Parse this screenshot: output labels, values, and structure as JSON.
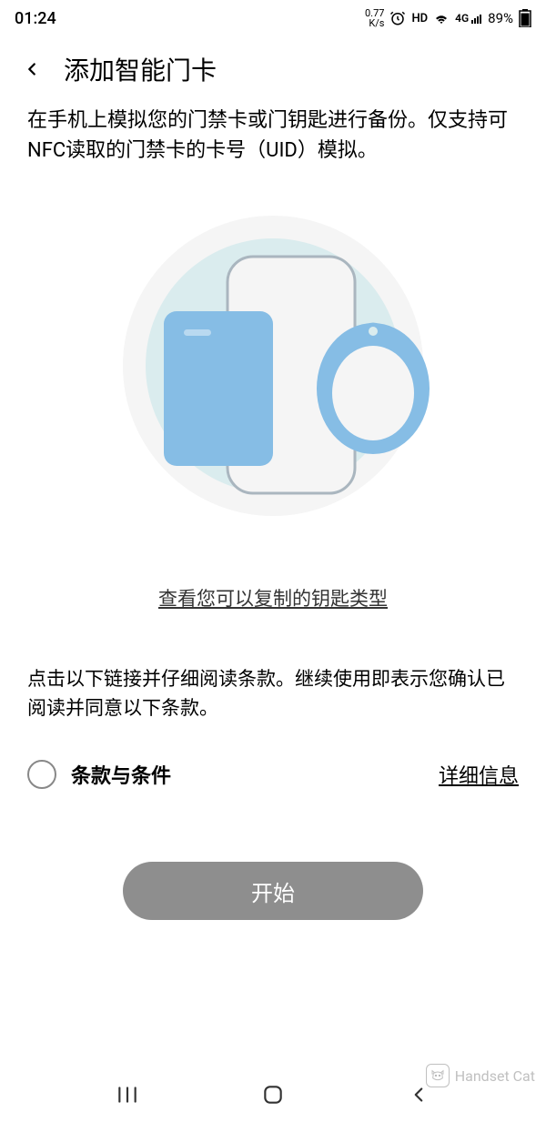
{
  "status": {
    "time": "01:24",
    "kbs_top": "0.77",
    "kbs_bottom": "K/s",
    "hd": "HD",
    "network": "4G",
    "battery_pct": "89%"
  },
  "header": {
    "title": "添加智能门卡"
  },
  "description": "在手机上模拟您的门禁卡或门钥匙进行备份。仅支持可NFC读取的门禁卡的卡号（UID）模拟。",
  "key_types_link": "查看您可以复制的钥匙类型",
  "terms_instruction": "点击以下链接并仔细阅读条款。继续使用即表示您确认已阅读并同意以下条款。",
  "terms": {
    "label": "条款与条件",
    "details": "详细信息"
  },
  "start_button": "开始",
  "watermark": "Handset Cat"
}
